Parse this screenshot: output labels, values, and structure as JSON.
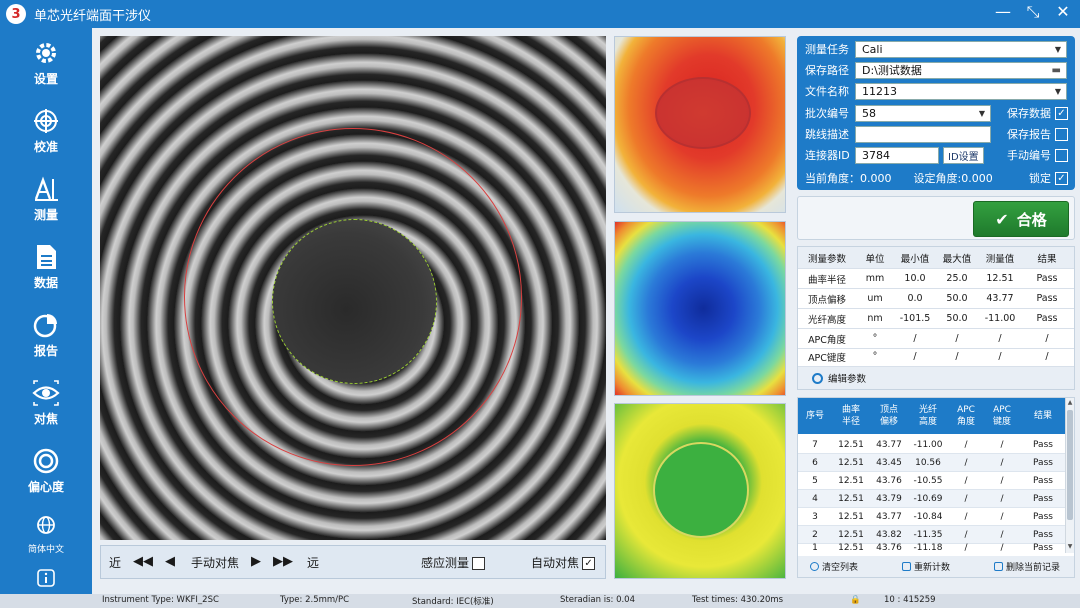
{
  "window": {
    "title": "单芯光纤端面干涉仪",
    "logo_text": "3",
    "controls": {
      "minimize": "—",
      "restore": "⤡",
      "close": "✕"
    }
  },
  "sidebar": {
    "items": [
      {
        "label": "设置",
        "icon": "gear-icon"
      },
      {
        "label": "校准",
        "icon": "target-icon"
      },
      {
        "label": "测量",
        "icon": "measure-icon"
      },
      {
        "label": "数据",
        "icon": "document-icon"
      },
      {
        "label": "报告",
        "icon": "pie-chart-icon"
      },
      {
        "label": "对焦",
        "icon": "eye-focus-icon"
      },
      {
        "label": "偏心度",
        "icon": "concentric-circle-icon"
      },
      {
        "label": "简体中文",
        "icon": "globe-icon"
      },
      {
        "label": "",
        "icon": "info-icon"
      }
    ]
  },
  "focus_bar": {
    "near": "近",
    "manual_focus": "手动对焦",
    "far": "远",
    "sense_measure": "感应测量",
    "sense_measure_checked": false,
    "auto_focus": "自动对焦",
    "auto_focus_checked": true
  },
  "form": {
    "task_label": "测量任务",
    "task_value": "Cali",
    "path_label": "保存路径",
    "path_value": "D:\\测试数据",
    "file_label": "文件名称",
    "file_value": "11213",
    "batch_label": "批次编号",
    "batch_value": "58",
    "save_data_label": "保存数据",
    "save_data_checked": true,
    "desc_label": "跳线描述",
    "desc_value": "",
    "save_report_label": "保存报告",
    "save_report_checked": false,
    "conn_label": "连接器ID",
    "conn_value": "3784",
    "id_button": "ID设置",
    "manual_num_label": "手动编号",
    "manual_num_checked": false,
    "current_angle": "当前角度：0.000",
    "set_angle": "设定角度:0.000",
    "lock_label": "锁定",
    "lock_checked": true
  },
  "result": {
    "label": "合格",
    "color": "#2a8a36"
  },
  "measure_table": {
    "headers": [
      "测量参数",
      "单位",
      "最小值",
      "最大值",
      "测量值",
      "结果"
    ],
    "rows": [
      [
        "曲率半径",
        "mm",
        "10.0",
        "25.0",
        "12.51",
        "Pass"
      ],
      [
        "顶点偏移",
        "um",
        "0.0",
        "50.0",
        "43.77",
        "Pass"
      ],
      [
        "光纤高度",
        "nm",
        "-101.5",
        "50.0",
        "-11.00",
        "Pass"
      ],
      [
        "APC角度",
        "°",
        "/",
        "/",
        "/",
        "/"
      ],
      [
        "APC键度",
        "°",
        "/",
        "/",
        "/",
        "/"
      ]
    ],
    "footer": "编辑参数"
  },
  "history_table": {
    "headers": [
      "序号",
      "曲率\n半径",
      "顶点\n偏移",
      "光纤\n高度",
      "APC\n角度",
      "APC\n键度",
      "结果"
    ],
    "rows": [
      [
        "7",
        "12.51",
        "43.77",
        "-11.00",
        "/",
        "/",
        "Pass"
      ],
      [
        "6",
        "12.51",
        "43.45",
        "10.56",
        "/",
        "/",
        "Pass"
      ],
      [
        "5",
        "12.51",
        "43.76",
        "-10.55",
        "/",
        "/",
        "Pass"
      ],
      [
        "4",
        "12.51",
        "43.79",
        "-10.69",
        "/",
        "/",
        "Pass"
      ],
      [
        "3",
        "12.51",
        "43.77",
        "-10.84",
        "/",
        "/",
        "Pass"
      ],
      [
        "2",
        "12.51",
        "43.82",
        "-11.35",
        "/",
        "/",
        "Pass"
      ],
      [
        "1",
        "12.51",
        "43.76",
        "-11.18",
        "/",
        "/",
        "Pass"
      ]
    ],
    "actions": {
      "clear": "清空列表",
      "recount": "重新计数",
      "delete": "删除当前记录"
    }
  },
  "status": {
    "instrument": "Instrument Type:  WKFI_2SC",
    "type": "Type:  2.5mm/PC",
    "standard": "Standard:  IEC(标准)",
    "steradian": "Steradian is: 0.04",
    "test_times": "Test times: 430.20ms",
    "count": "10  :  415259"
  }
}
